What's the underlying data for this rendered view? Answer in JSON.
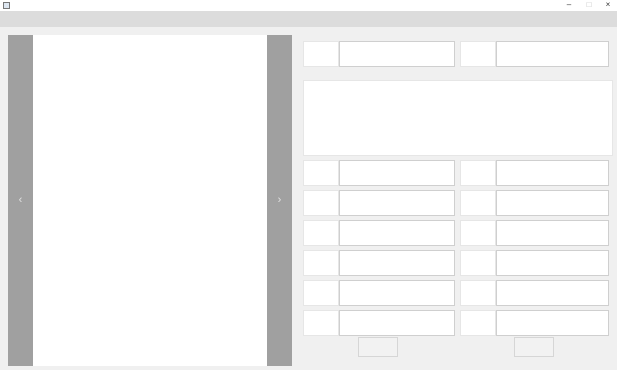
{
  "window": {
    "title": "",
    "minimize_glyph": "–",
    "maximize_glyph": "□",
    "close_glyph": "×"
  },
  "menu": {
    "items": [
      {
        "label": ""
      },
      {
        "label": ""
      },
      {
        "label": ""
      }
    ]
  },
  "viewer": {
    "prev_glyph": "‹",
    "next_glyph": "›"
  },
  "form": {
    "top_row": [
      {
        "label": ""
      },
      {
        "label": ""
      }
    ],
    "notes_label": "",
    "left_fields": [
      {
        "label": ""
      },
      {
        "label": ""
      },
      {
        "label": ""
      },
      {
        "label": ""
      },
      {
        "label": ""
      },
      {
        "label": ""
      }
    ],
    "right_fields": [
      {
        "label": ""
      },
      {
        "label": ""
      },
      {
        "label": ""
      },
      {
        "label": ""
      },
      {
        "label": ""
      },
      {
        "label": ""
      }
    ]
  },
  "buttons": {
    "left_label": "",
    "right_label": ""
  },
  "colors": {
    "menubar": "#dcdcdc",
    "nav_bar": "#a0a0a0",
    "viewer": "#ffffff",
    "client": "#f0f0f0"
  },
  "icons": [
    "app-icon",
    "chevron-left-icon",
    "chevron-right-icon",
    "minimize-icon",
    "maximize-icon",
    "close-icon"
  ]
}
